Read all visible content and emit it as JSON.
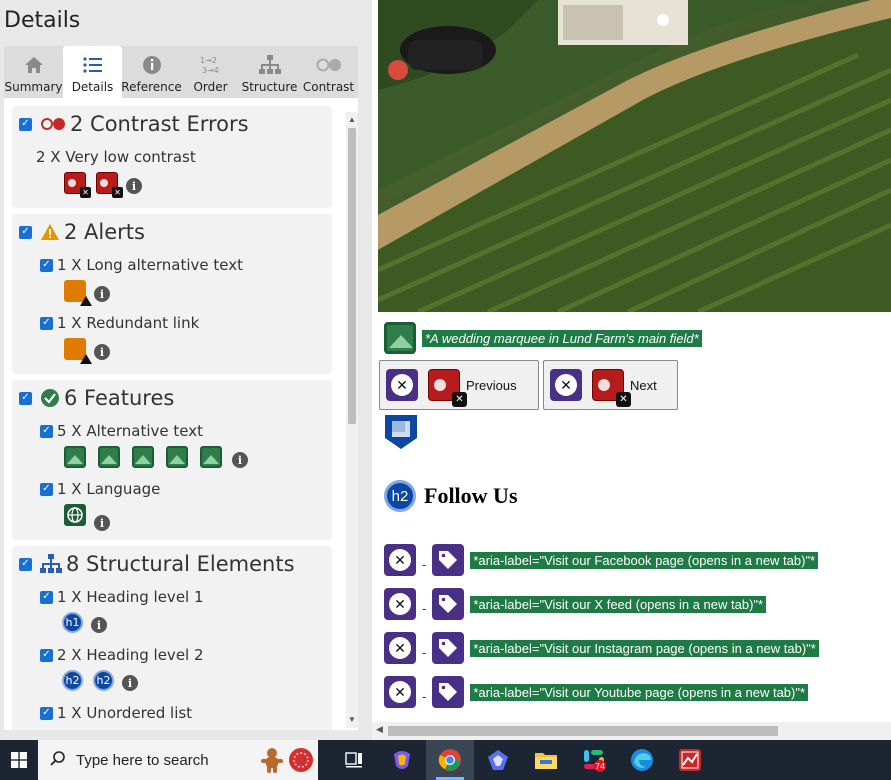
{
  "panel": {
    "title": "Details",
    "tabs": [
      {
        "label": "Summary",
        "icon": "home-icon"
      },
      {
        "label": "Details",
        "icon": "list-icon"
      },
      {
        "label": "Reference",
        "icon": "info-icon"
      },
      {
        "label": "Order",
        "icon": "order-icon"
      },
      {
        "label": "Structure",
        "icon": "structure-icon"
      },
      {
        "label": "Contrast",
        "icon": "contrast-icon"
      }
    ],
    "active_tab": "Details",
    "sections": {
      "contrast": {
        "title": "2 Contrast Errors",
        "item": "2 X Very low contrast"
      },
      "alerts": {
        "title": "2 Alerts",
        "items": [
          "1 X Long alternative text",
          "1 X Redundant link"
        ]
      },
      "features": {
        "title": "6 Features",
        "items": [
          "5 X Alternative text",
          "1 X Language"
        ]
      },
      "structure": {
        "title": "8 Structural Elements",
        "items": [
          "1 X Heading level 1",
          "2 X Heading level 2",
          "1 X Unordered list"
        ]
      }
    },
    "badges": {
      "h1": "h1",
      "h2": "h2"
    }
  },
  "page": {
    "caption": "*A wedding marquee in Lund Farm's main field*",
    "prev_label": "Previous",
    "next_label": "Next",
    "heading_badge": "h2",
    "heading": "Follow Us",
    "social_links": [
      "*aria-label=\"Visit our Facebook page (opens in a new tab)\"*",
      "*aria-label=\"Visit our X feed (opens in a new tab)\"*",
      "*aria-label=\"Visit our Instagram page (opens in a new tab)\"*",
      "*aria-label=\"Visit our Youtube page (opens in a new tab)\"*"
    ],
    "dash": "-"
  },
  "taskbar": {
    "search_placeholder": "Type here to search",
    "apps": [
      "task-view-icon",
      "copilot-icon",
      "chrome-icon",
      "copilot-app-icon",
      "file-explorer-icon",
      "slack-icon",
      "edge-icon",
      "app-icon"
    ],
    "slack_badge": "74"
  },
  "colors": {
    "highlight": "#1e7b45",
    "error": "#b71c1c",
    "purple": "#4a2f86",
    "heading_badge": "#0d47a1",
    "taskbar": "#1c2633"
  }
}
